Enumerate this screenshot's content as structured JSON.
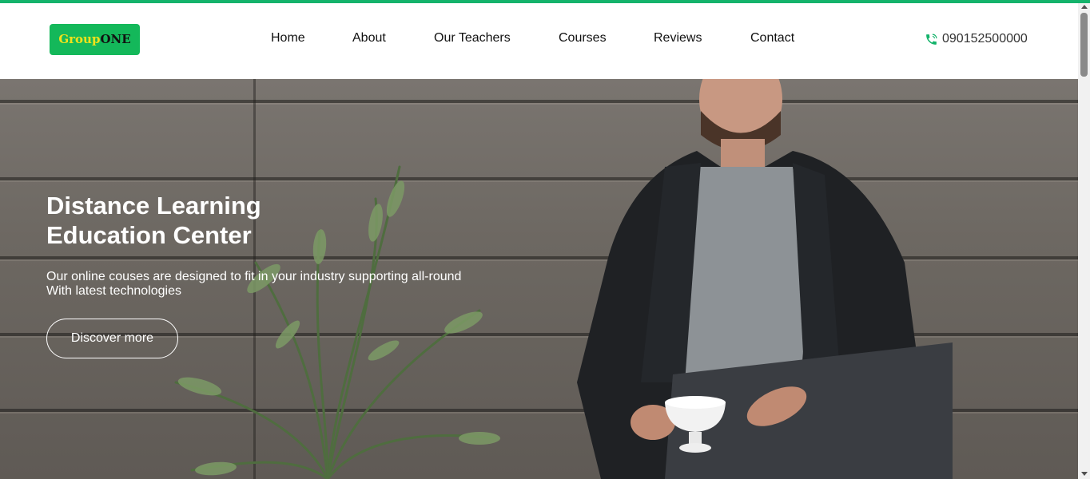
{
  "brand": {
    "part1": "Group",
    "part2": "ONE",
    "accent": "#14b85a"
  },
  "nav": {
    "items": [
      {
        "label": "Home"
      },
      {
        "label": "About"
      },
      {
        "label": "Our Teachers"
      },
      {
        "label": "Courses"
      },
      {
        "label": "Reviews"
      },
      {
        "label": "Contact"
      }
    ]
  },
  "contact": {
    "icon": "phone-icon",
    "phone": "090152500000"
  },
  "hero": {
    "title_line1": "Distance Learning",
    "title_line2": "Education Center",
    "subtitle_line1": "Our online couses are designed to fit in your industry supporting all-round",
    "subtitle_line2": "With latest technologies",
    "cta_label": "Discover more"
  },
  "colors": {
    "topline": "#14b36b",
    "header_bg": "#ffffff",
    "hero_text": "#ffffff"
  }
}
